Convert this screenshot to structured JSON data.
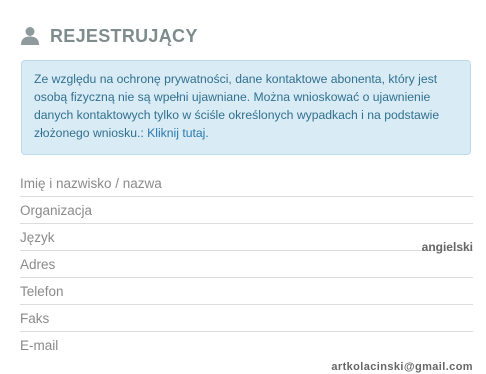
{
  "section": {
    "icon": "user-icon",
    "title": "REJESTRUJĄCY"
  },
  "notice": {
    "text": "Ze względu na ochronę prywatności, dane kontaktowe abonenta, który jest osobą fizyczną nie są wpełni ujawniane. Można wnioskować o ujawnienie danych kontaktowych tylko w ściśle określonych wypadkach i na podstawie złożonego wniosku.: ",
    "link_label": "Kliknij tutaj.",
    "bg_color": "#d9ecf5",
    "text_color": "#31708f"
  },
  "fields": [
    {
      "label": "Imię i nazwisko / nazwa",
      "value": ""
    },
    {
      "label": "Organizacja",
      "value": ""
    },
    {
      "label": "Język",
      "value": "angielski"
    },
    {
      "label": "Adres",
      "value": ""
    },
    {
      "label": "Telefon",
      "value": ""
    },
    {
      "label": "Faks",
      "value": ""
    },
    {
      "label": "E-mail",
      "value": "artkolacinski@gmail.com"
    }
  ]
}
